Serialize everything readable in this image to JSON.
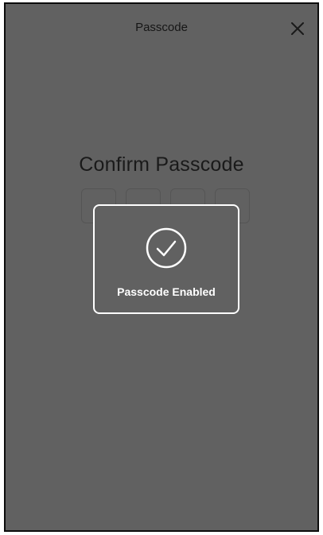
{
  "header": {
    "title": "Passcode",
    "close_icon": "close-icon"
  },
  "main": {
    "heading": "Confirm Passcode",
    "entered_digits": 4,
    "total_digits": 4
  },
  "toast": {
    "icon": "check-circle-icon",
    "message": "Passcode Enabled"
  },
  "colors": {
    "overlay_background": "#616161",
    "toast_border": "#ffffff",
    "text_dark": "#1a1a1a"
  }
}
